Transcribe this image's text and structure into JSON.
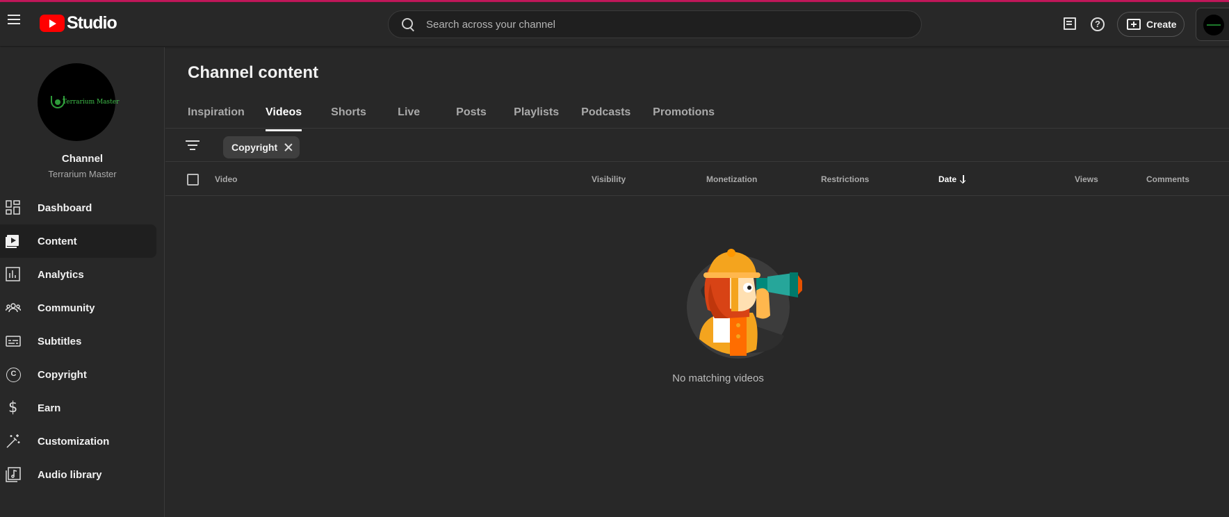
{
  "header": {
    "logo_text": "Studio",
    "search_placeholder": "Search across your channel",
    "create_label": "Create"
  },
  "sidebar": {
    "channel_title": "Channel",
    "channel_name": "Terrarium Master",
    "avatar_logo_text": "Terrarium Master",
    "items": [
      {
        "label": "Dashboard",
        "icon": "dashboard-icon"
      },
      {
        "label": "Content",
        "icon": "content-icon",
        "active": true
      },
      {
        "label": "Analytics",
        "icon": "analytics-icon"
      },
      {
        "label": "Community",
        "icon": "community-icon"
      },
      {
        "label": "Subtitles",
        "icon": "subtitles-icon"
      },
      {
        "label": "Copyright",
        "icon": "copyright-icon"
      },
      {
        "label": "Earn",
        "icon": "earn-icon"
      },
      {
        "label": "Customization",
        "icon": "customization-icon"
      },
      {
        "label": "Audio library",
        "icon": "audio-library-icon"
      }
    ]
  },
  "main": {
    "title": "Channel content",
    "tabs": [
      {
        "label": "Inspiration"
      },
      {
        "label": "Videos",
        "active": true
      },
      {
        "label": "Shorts"
      },
      {
        "label": "Live"
      },
      {
        "label": "Posts"
      },
      {
        "label": "Playlists"
      },
      {
        "label": "Podcasts"
      },
      {
        "label": "Promotions"
      }
    ],
    "filter_chip": "Copyright",
    "columns": {
      "video": "Video",
      "visibility": "Visibility",
      "monetization": "Monetization",
      "restrictions": "Restrictions",
      "date": "Date",
      "views": "Views",
      "comments": "Comments"
    },
    "empty_message": "No matching videos"
  },
  "colors": {
    "background": "#282828",
    "accent_red": "#ff0000",
    "top_bar": "#c2185b"
  }
}
